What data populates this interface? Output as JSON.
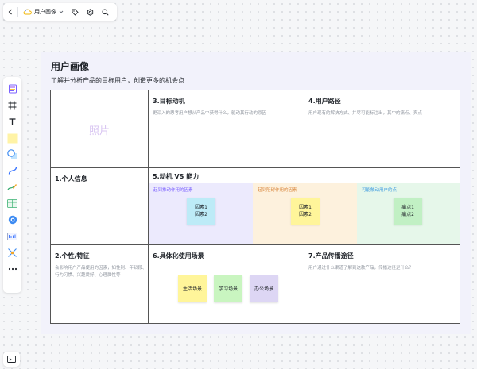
{
  "toolbar": {
    "file_name": "用户画像",
    "icons": [
      "back-icon",
      "cloud-icon",
      "chevron-down-icon",
      "tag-icon",
      "settings-icon",
      "search-icon"
    ]
  },
  "left_tools": [
    "template-icon",
    "frame-icon",
    "text-icon",
    "sticky-note-icon",
    "shape-icon",
    "connector-icon",
    "pen-icon",
    "table-icon",
    "mindmap-icon",
    "formula-icon",
    "more-tools-icon",
    "more-icon"
  ],
  "frame": {
    "title": "用户画像",
    "subtitle": "了解并分析产品的目标用户，创造更多的机会点"
  },
  "board": {
    "photo": "照片",
    "goal": {
      "title": "3.目标动机",
      "desc": "更深入的思考用户想从产品中获得什么，驱动其行动的原因"
    },
    "path": {
      "title": "4.用户路径",
      "desc": "用户现有的解决方式、并尽可能标注出，其中的痛点、爽点"
    },
    "personal": {
      "title": "1.个人信息"
    },
    "motive": {
      "title": "5.动机 VS 能力",
      "zones": [
        {
          "label": "起到推动作用的因素",
          "label_color": "#7b61ff",
          "bg": "#eceafd",
          "notes": [
            "因素1",
            "因素2"
          ],
          "note_color": "#bdebf7"
        },
        {
          "label": "起到阻碍作用的因素",
          "label_color": "#d8853a",
          "bg": "#fdf1dd",
          "notes": [
            "因素1",
            "因素2"
          ],
          "note_color": "#fff59a"
        },
        {
          "label": "可能触动用户的点",
          "label_color": "#3d9be0",
          "bg": "#e6f7ea",
          "notes": [
            "痛点1",
            "痛点2"
          ],
          "note_color": "#c1f0c4"
        }
      ]
    },
    "trait": {
      "title": "2.个性/特征",
      "desc": "会影响用户产品使用的因素，如性别、年龄段、行为习惯、兴趣爱好、心理属性等"
    },
    "scenes": {
      "title": "6.具体化使用场景",
      "notes": [
        {
          "label": "生活场景",
          "color": "#fff59a"
        },
        {
          "label": "学习场景",
          "color": "#c9f5c0"
        },
        {
          "label": "办公场景",
          "color": "#ddd6f4"
        }
      ]
    },
    "spread": {
      "title": "7.产品传播途径",
      "desc": "用户通过什么渠道了解到这款产品，传播途径是什么？"
    }
  }
}
